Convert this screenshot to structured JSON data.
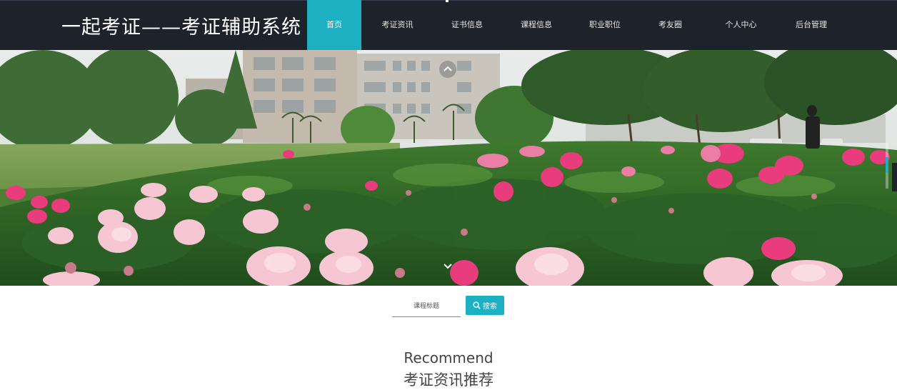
{
  "header": {
    "title": "一起考证——考证辅助系统",
    "active_color": "#1cb0c2",
    "bar_color": "#1e222b"
  },
  "nav": {
    "items": [
      {
        "label": "首页",
        "active": true
      },
      {
        "label": "考证资讯",
        "active": false
      },
      {
        "label": "证书信息",
        "active": false
      },
      {
        "label": "课程信息",
        "active": false
      },
      {
        "label": "职业职位",
        "active": false
      },
      {
        "label": "考友圈",
        "active": false
      },
      {
        "label": "个人中心",
        "active": false
      },
      {
        "label": "后台管理",
        "active": false
      }
    ]
  },
  "banner": {
    "up_icon": "chevron-up-icon",
    "down_icon": "chevron-down-icon"
  },
  "search": {
    "placeholder": "课程标题",
    "button_label": "搜索",
    "button_icon": "search-icon"
  },
  "recommend": {
    "title_en": "Recommend",
    "title_cn": "考证资讯推荐"
  }
}
